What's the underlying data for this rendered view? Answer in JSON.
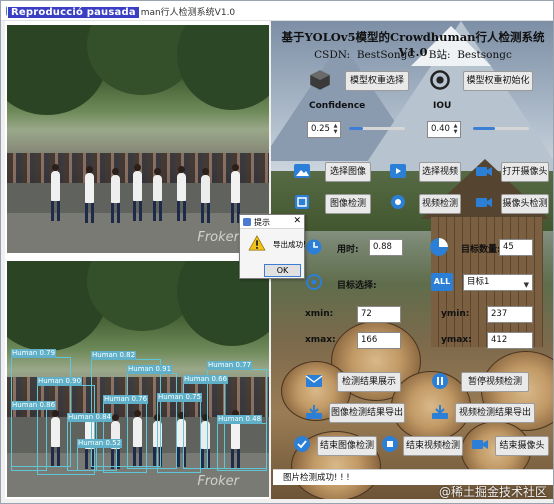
{
  "window": {
    "title": "基于YOLOv5模型的Crowdhuman行人检测系统V1.0",
    "title_prefix": "基于YOLOv5模型的Crowdhuman行人检测系统V1.0",
    "video_overlay_caption": "Reproducció pausada"
  },
  "header": {
    "title": "基于YOLOv5模型的Crowdhuman行人检测系统V1.0",
    "csdn_label": "CSDN:",
    "csdn_value": "BestSongC",
    "bilibili_label": "B站:",
    "bilibili_value": "Bestsongc"
  },
  "model": {
    "select_weights_label": "模型权重选择",
    "init_weights_label": "模型权重初始化",
    "confidence_label": "Confidence",
    "confidence_value": "0.25",
    "confidence_fraction": 0.25,
    "iou_label": "IOU",
    "iou_value": "0.40",
    "iou_fraction": 0.4
  },
  "actions": {
    "select_image": "选择图像",
    "select_video": "选择视频",
    "open_camera": "打开摄像头",
    "image_detect": "图像检测",
    "video_detect": "视频检测",
    "camera_detect": "摄像头检测"
  },
  "results": {
    "time_label": "用时:",
    "time_value": "0.88",
    "target_count_label": "目标数量:",
    "target_count_value": "45",
    "target_select_label": "目标选择:",
    "target_select_value": "目标1",
    "xmin_label": "xmin:",
    "xmin_value": "72",
    "ymin_label": "ymin:",
    "ymin_value": "237",
    "xmax_label": "xmax:",
    "xmax_value": "166",
    "ymax_label": "ymax:",
    "ymax_value": "412"
  },
  "bottom_actions": {
    "show_results": "检测结果展示",
    "pause_video": "暂停视频检测",
    "export_image_results": "图像检测结果导出",
    "export_video_results": "视频检测结果导出",
    "end_image_detect": "结束图像检测",
    "end_video_detect": "结束视频检测",
    "close_camera": "结束摄像头"
  },
  "status": {
    "message": "图片检测成功! ! !"
  },
  "dialog": {
    "title": "提示",
    "message": "导出成功!",
    "ok_label": "OK"
  },
  "frame_watermark": "Froker",
  "site_watermark": "@稀土掘金技术社区",
  "detections": [
    {
      "label": "Human 0.79"
    },
    {
      "label": "Human 0.82"
    },
    {
      "label": "Human 0.77"
    },
    {
      "label": "Human 0.90"
    },
    {
      "label": "Human 0.91"
    },
    {
      "label": "Human 0.66"
    },
    {
      "label": "Human 0.86"
    },
    {
      "label": "Human 0.76"
    },
    {
      "label": "Human 0.75"
    },
    {
      "label": "Human 0.84"
    },
    {
      "label": "Human 0.48"
    },
    {
      "label": "Human 0.52"
    }
  ],
  "colors": {
    "accent": "#3b7ed4",
    "detection_box": "#5fc6d8",
    "overlay_caption_bg": "#3a3fc4"
  }
}
